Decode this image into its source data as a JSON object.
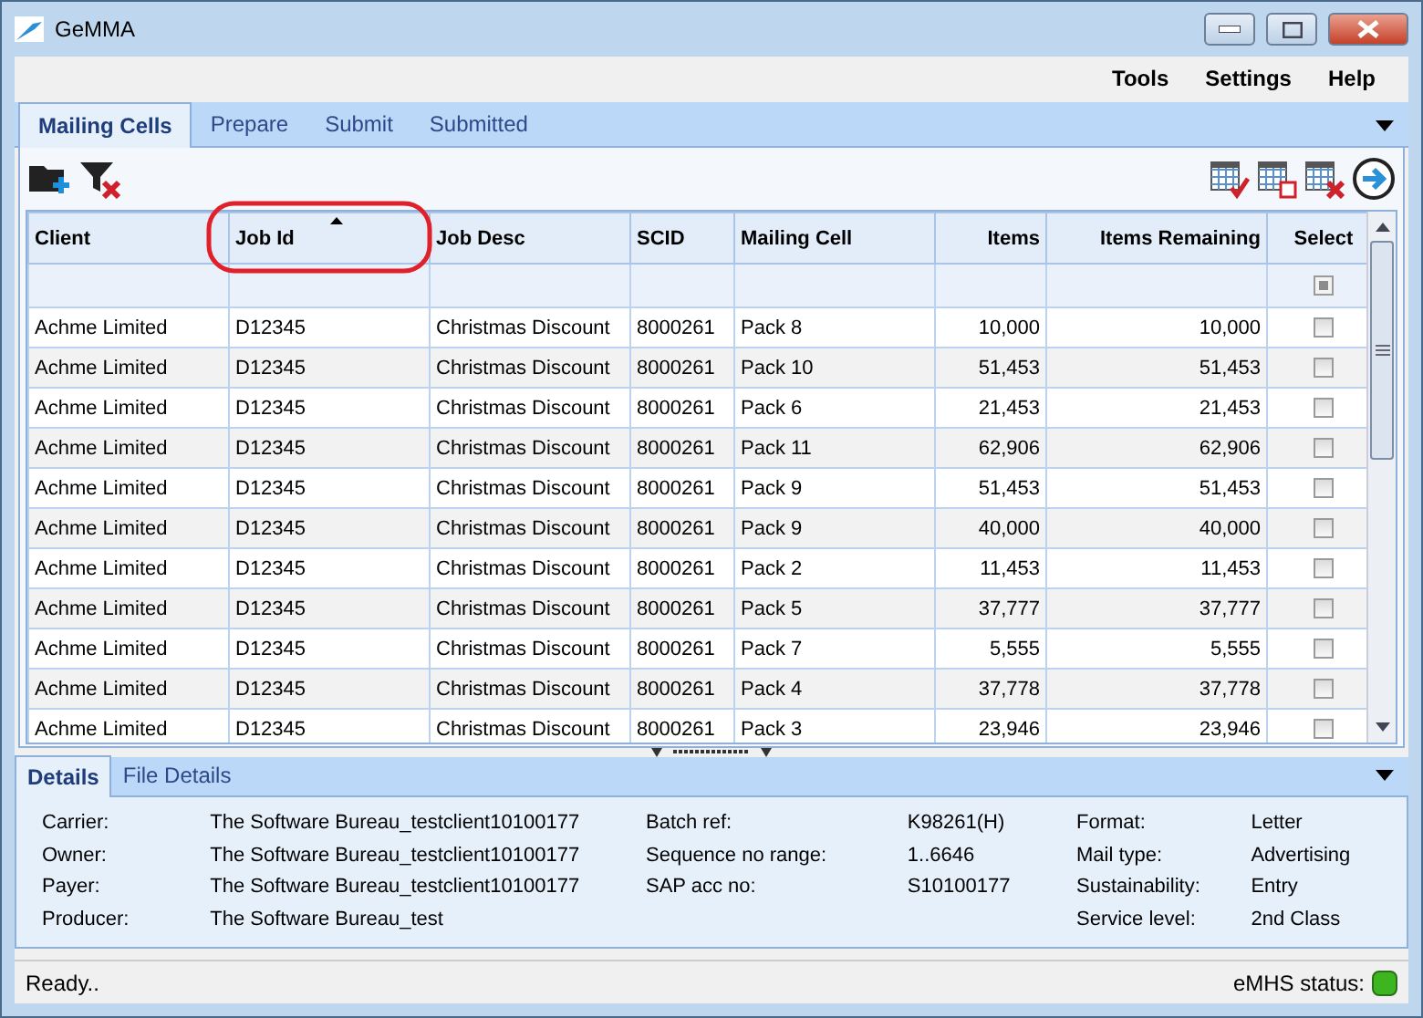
{
  "window": {
    "title": "GeMMA"
  },
  "menu": [
    "Tools",
    "Settings",
    "Help"
  ],
  "tabs": [
    {
      "label": "Mailing Cells",
      "selected": true
    },
    {
      "label": "Prepare",
      "selected": false
    },
    {
      "label": "Submit",
      "selected": false
    },
    {
      "label": "Submitted",
      "selected": false
    }
  ],
  "table": {
    "columns": [
      {
        "label": "Client",
        "kind": "text",
        "sorted": false,
        "highlighted": false
      },
      {
        "label": "Job Id",
        "kind": "text",
        "sorted": true,
        "highlighted": true
      },
      {
        "label": "Job Desc",
        "kind": "text",
        "sorted": false,
        "highlighted": false
      },
      {
        "label": "SCID",
        "kind": "text",
        "sorted": false,
        "highlighted": false
      },
      {
        "label": "Mailing Cell",
        "kind": "text",
        "sorted": false,
        "highlighted": false
      },
      {
        "label": "Items",
        "kind": "number",
        "sorted": false,
        "highlighted": false
      },
      {
        "label": "Items Remaining",
        "kind": "number",
        "sorted": false,
        "highlighted": false
      },
      {
        "label": "Select",
        "kind": "checkbox",
        "sorted": false,
        "highlighted": false
      }
    ],
    "select_all": {
      "indeterminate": true
    },
    "rows": [
      {
        "cells": [
          "Achme Limited",
          "D12345",
          "Christmas Discount",
          "8000261",
          "Pack 8",
          "10,000",
          "10,000"
        ],
        "checked": false
      },
      {
        "cells": [
          "Achme Limited",
          "D12345",
          "Christmas Discount",
          "8000261",
          "Pack 10",
          "51,453",
          "51,453"
        ],
        "checked": false
      },
      {
        "cells": [
          "Achme Limited",
          "D12345",
          "Christmas Discount",
          "8000261",
          "Pack 6",
          "21,453",
          "21,453"
        ],
        "checked": false
      },
      {
        "cells": [
          "Achme Limited",
          "D12345",
          "Christmas Discount",
          "8000261",
          "Pack 11",
          "62,906",
          "62,906"
        ],
        "checked": false
      },
      {
        "cells": [
          "Achme Limited",
          "D12345",
          "Christmas Discount",
          "8000261",
          "Pack 9",
          "51,453",
          "51,453"
        ],
        "checked": false
      },
      {
        "cells": [
          "Achme Limited",
          "D12345",
          "Christmas Discount",
          "8000261",
          "Pack 9",
          "40,000",
          "40,000"
        ],
        "checked": false
      },
      {
        "cells": [
          "Achme Limited",
          "D12345",
          "Christmas Discount",
          "8000261",
          "Pack 2",
          "11,453",
          "11,453"
        ],
        "checked": false
      },
      {
        "cells": [
          "Achme Limited",
          "D12345",
          "Christmas Discount",
          "8000261",
          "Pack 5",
          "37,777",
          "37,777"
        ],
        "checked": false
      },
      {
        "cells": [
          "Achme Limited",
          "D12345",
          "Christmas Discount",
          "8000261",
          "Pack 7",
          "5,555",
          "5,555"
        ],
        "checked": false
      },
      {
        "cells": [
          "Achme Limited",
          "D12345",
          "Christmas Discount",
          "8000261",
          "Pack 4",
          "37,778",
          "37,778"
        ],
        "checked": false
      },
      {
        "cells": [
          "Achme Limited",
          "D12345",
          "Christmas Discount",
          "8000261",
          "Pack 3",
          "23,946",
          "23,946"
        ],
        "checked": false
      }
    ]
  },
  "details": {
    "tabs": [
      {
        "label": "Details",
        "selected": true
      },
      {
        "label": "File Details",
        "selected": false
      }
    ],
    "columns": [
      [
        {
          "label": "Carrier:",
          "value": "The Software Bureau_testclient10100177"
        },
        {
          "label": "Owner:",
          "value": "The Software Bureau_testclient10100177"
        },
        {
          "label": "Payer:",
          "value": "The Software Bureau_testclient10100177"
        },
        {
          "label": "Producer:",
          "value": "The Software Bureau_test"
        }
      ],
      [
        {
          "label": "Batch ref:",
          "value": "K98261(H)"
        },
        {
          "label": "Sequence no range:",
          "value": "1..6646"
        },
        {
          "label": "SAP acc no:",
          "value": "S10100177"
        }
      ],
      [
        {
          "label": "Format:",
          "value": "Letter"
        },
        {
          "label": "Mail type:",
          "value": "Advertising"
        },
        {
          "label": "Sustainability:",
          "value": "Entry"
        },
        {
          "label": "Service level:",
          "value": "2nd Class"
        }
      ]
    ]
  },
  "status_bar": {
    "text": "Ready..",
    "emhs_label": "eMHS status:"
  }
}
